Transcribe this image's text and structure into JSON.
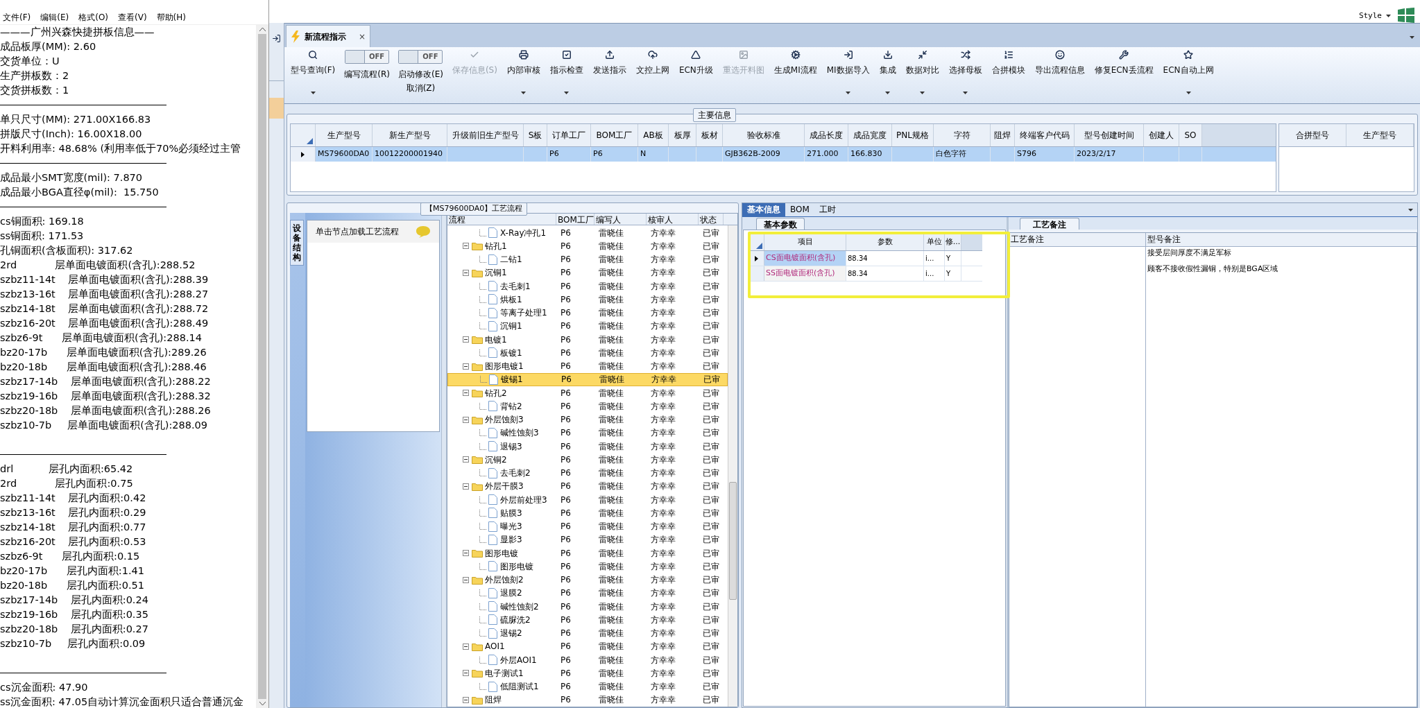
{
  "notepad": {
    "menu": [
      "文件(F)",
      "编辑(E)",
      "格式(O)",
      "查看(V)",
      "帮助(H)"
    ],
    "lines": [
      {
        "kind": "text",
        "text": "———广州兴森快捷拼板信息——"
      },
      {
        "kind": "text",
        "text": "成品板厚(MM): 2.60"
      },
      {
        "kind": "text",
        "text": "交货单位：U"
      },
      {
        "kind": "text",
        "text": "生产拼板数：2"
      },
      {
        "kind": "text",
        "text": "交货拼板数：1"
      },
      {
        "kind": "rule"
      },
      {
        "kind": "text",
        "text": "单只尺寸(MM): 271.00X166.83"
      },
      {
        "kind": "text",
        "text": "拼版尺寸(Inch): 16.00X18.00"
      },
      {
        "kind": "text",
        "text": "开料利用率: 48.68% (利用率低于70%必须经过主管"
      },
      {
        "kind": "rule"
      },
      {
        "kind": "text",
        "text": "成品最小SMT宽度(mil): 7.870"
      },
      {
        "kind": "text",
        "text": "成品最小BGA直径φ(mil):  15.750"
      },
      {
        "kind": "rule"
      },
      {
        "kind": "text",
        "text": "cs铜面积: 169.18"
      },
      {
        "kind": "text",
        "text": "ss铜面积: 171.53"
      },
      {
        "kind": "text",
        "text": "孔铜面积(含板面积): 317.62"
      },
      {
        "kind": "text",
        "text": "2rd            层单面电镀面积(含孔):288.52"
      },
      {
        "kind": "text",
        "text": "szbz11-14t    层单面电镀面积(含孔):288.39"
      },
      {
        "kind": "text",
        "text": "szbz13-16t    层单面电镀面积(含孔):288.27"
      },
      {
        "kind": "text",
        "text": "szbz14-18t    层单面电镀面积(含孔):288.72"
      },
      {
        "kind": "text",
        "text": "szbz16-20t    层单面电镀面积(含孔):288.49"
      },
      {
        "kind": "text",
        "text": "szbz6-9t      层单面电镀面积(含孔):288.14"
      },
      {
        "kind": "text",
        "text": "bz20-17b      层单面电镀面积(含孔):289.26"
      },
      {
        "kind": "text",
        "text": "bz20-18b      层单面电镀面积(含孔):288.46"
      },
      {
        "kind": "text",
        "text": "szbz17-14b    层单面电镀面积(含孔):288.22"
      },
      {
        "kind": "text",
        "text": "szbz19-16b    层单面电镀面积(含孔):288.32"
      },
      {
        "kind": "text",
        "text": "szbz20-18b    层单面电镀面积(含孔):288.26"
      },
      {
        "kind": "text",
        "text": "szbz10-7b     层单面电镀面积(含孔):288.09"
      },
      {
        "kind": "blank"
      },
      {
        "kind": "rule"
      },
      {
        "kind": "text",
        "text": "drl           层孔内面积:65.42"
      },
      {
        "kind": "text",
        "text": "2rd            层孔内面积:0.75"
      },
      {
        "kind": "text",
        "text": "szbz11-14t    层孔内面积:0.42"
      },
      {
        "kind": "text",
        "text": "szbz13-16t    层孔内面积:0.29"
      },
      {
        "kind": "text",
        "text": "szbz14-18t    层孔内面积:0.77"
      },
      {
        "kind": "text",
        "text": "szbz16-20t    层孔内面积:0.53"
      },
      {
        "kind": "text",
        "text": "szbz6-9t      层孔内面积:0.15"
      },
      {
        "kind": "text",
        "text": "bz20-17b      层孔内面积:1.41"
      },
      {
        "kind": "text",
        "text": "bz20-18b      层孔内面积:0.51"
      },
      {
        "kind": "text",
        "text": "szbz17-14b    层孔内面积:0.24"
      },
      {
        "kind": "text",
        "text": "szbz19-16b    层孔内面积:0.35"
      },
      {
        "kind": "text",
        "text": "szbz20-18b    层孔内面积:0.27"
      },
      {
        "kind": "text",
        "text": "szbz10-7b     层孔内面积:0.09"
      },
      {
        "kind": "blank"
      },
      {
        "kind": "rule"
      },
      {
        "kind": "text",
        "text": "cs沉金面积: 47.90"
      },
      {
        "kind": "text",
        "text": "ss沉金面积: 47.05自动计算沉金面积只适合普通沉金"
      }
    ]
  },
  "app": {
    "style_menu": "Style",
    "doc_tab": {
      "label": "新流程指示",
      "close": "×"
    },
    "ribbon": [
      {
        "kind": "button",
        "label": "型号查询(F)",
        "dropdown": true,
        "disabled": false
      },
      {
        "kind": "toggle",
        "switch": "OFF",
        "on": false,
        "label": "编写流程(R)"
      },
      {
        "kind": "toggle",
        "switch": "OFF",
        "on": false,
        "label": "启动修改(E)",
        "label2": "取消(Z)"
      },
      {
        "kind": "button",
        "label": "保存信息(S)",
        "dropdown": false,
        "disabled": true
      },
      {
        "kind": "button",
        "label": "内部审核",
        "dropdown": true,
        "disabled": false
      },
      {
        "kind": "button",
        "label": "指示检查",
        "dropdown": true,
        "disabled": false
      },
      {
        "kind": "button",
        "label": "发送指示",
        "dropdown": false,
        "disabled": false
      },
      {
        "kind": "button",
        "label": "文控上网",
        "dropdown": false,
        "disabled": false
      },
      {
        "kind": "button",
        "label": "ECN升级",
        "dropdown": false,
        "disabled": false
      },
      {
        "kind": "button",
        "label": "重选开料图",
        "dropdown": false,
        "disabled": true
      },
      {
        "kind": "button",
        "label": "生成MI流程",
        "dropdown": false,
        "disabled": false
      },
      {
        "kind": "button",
        "label": "MI数据导入",
        "dropdown": true,
        "disabled": false
      },
      {
        "kind": "button",
        "label": "集成",
        "dropdown": true,
        "disabled": false
      },
      {
        "kind": "button",
        "label": "数据对比",
        "dropdown": true,
        "disabled": false
      },
      {
        "kind": "button",
        "label": "选择母板",
        "dropdown": true,
        "disabled": false
      },
      {
        "kind": "button",
        "label": "合拼模块",
        "dropdown": false,
        "disabled": false
      },
      {
        "kind": "button",
        "label": "导出流程信息",
        "dropdown": false,
        "disabled": false
      },
      {
        "kind": "button",
        "label": "修复ECN丢流程",
        "dropdown": false,
        "disabled": false
      },
      {
        "kind": "button",
        "label": "ECN自动上网",
        "dropdown": true,
        "disabled": false
      }
    ],
    "main_info": {
      "title": "主要信息",
      "columns": [
        "生产型号",
        "新生产型号",
        "升级前旧生产型号",
        "S板",
        "订单工厂",
        "BOM工厂",
        "AB板",
        "板厚",
        "板材",
        "验收标准",
        "成品长度",
        "成品宽度",
        "PNL规格",
        "字符",
        "阻焊",
        "终端客户代码",
        "型号创建时间",
        "创建人",
        "SO"
      ],
      "rows": [
        {
          "selected": true,
          "cells": [
            "MS79600DA0",
            "10012200001940",
            "",
            "",
            "P6",
            "P6",
            "N",
            "",
            "",
            "GJB362B-2009",
            "271.000",
            "166.830",
            "",
            "白色字符",
            "",
            "S796",
            "2023/2/17",
            "",
            ""
          ]
        }
      ],
      "side_columns": [
        "合拼型号",
        "生产型号"
      ]
    },
    "process": {
      "side_tab": "设备结构",
      "hint": "单击节点加载工艺流程",
      "title": "【MS79600DA0】工艺流程",
      "columns": [
        "流程",
        "BOM工厂",
        "编写人",
        "核审人",
        "状态"
      ],
      "tree": [
        {
          "kind": "doc",
          "label": "X-Ray冲孔1",
          "bom": "P6",
          "author": "雷晓佳",
          "reviewer": "方幸幸",
          "status": "已审",
          "selected": false
        },
        {
          "kind": "folder",
          "label": "钻孔1",
          "bom": "P6",
          "author": "雷晓佳",
          "reviewer": "方幸幸",
          "status": "已审",
          "selected": false,
          "expanded": true,
          "children": [
            {
              "kind": "doc",
              "label": "二钻1",
              "bom": "P6",
              "author": "雷晓佳",
              "reviewer": "方幸幸",
              "status": "已审",
              "selected": false
            }
          ]
        },
        {
          "kind": "folder",
          "label": "沉铜1",
          "bom": "P6",
          "author": "雷晓佳",
          "reviewer": "方幸幸",
          "status": "已审",
          "selected": false,
          "expanded": true,
          "children": [
            {
              "kind": "doc",
              "label": "去毛刺1",
              "bom": "P6",
              "author": "雷晓佳",
              "reviewer": "方幸幸",
              "status": "已审",
              "selected": false
            },
            {
              "kind": "doc",
              "label": "烘板1",
              "bom": "P6",
              "author": "雷晓佳",
              "reviewer": "方幸幸",
              "status": "已审",
              "selected": false
            },
            {
              "kind": "doc",
              "label": "等离子处理1",
              "bom": "P6",
              "author": "雷晓佳",
              "reviewer": "方幸幸",
              "status": "已审",
              "selected": false
            },
            {
              "kind": "doc",
              "label": "沉铜1",
              "bom": "P6",
              "author": "雷晓佳",
              "reviewer": "方幸幸",
              "status": "已审",
              "selected": false
            }
          ]
        },
        {
          "kind": "folder",
          "label": "电镀1",
          "bom": "P6",
          "author": "雷晓佳",
          "reviewer": "方幸幸",
          "status": "已审",
          "selected": false,
          "expanded": true,
          "children": [
            {
              "kind": "doc",
              "label": "板镀1",
              "bom": "P6",
              "author": "雷晓佳",
              "reviewer": "方幸幸",
              "status": "已审",
              "selected": false
            }
          ]
        },
        {
          "kind": "folder",
          "label": "图形电镀1",
          "bom": "P6",
          "author": "雷晓佳",
          "reviewer": "方幸幸",
          "status": "已审",
          "selected": false,
          "expanded": true,
          "children": [
            {
              "kind": "doc",
              "label": "镀锡1",
              "bom": "P6",
              "author": "雷晓佳",
              "reviewer": "方幸幸",
              "status": "已审",
              "selected": true
            }
          ]
        },
        {
          "kind": "folder",
          "label": "钻孔2",
          "bom": "P6",
          "author": "雷晓佳",
          "reviewer": "方幸幸",
          "status": "已审",
          "selected": false,
          "expanded": true,
          "children": [
            {
              "kind": "doc",
              "label": "背钻2",
              "bom": "P6",
              "author": "雷晓佳",
              "reviewer": "方幸幸",
              "status": "已审",
              "selected": false
            }
          ]
        },
        {
          "kind": "folder",
          "label": "外层蚀刻3",
          "bom": "P6",
          "author": "雷晓佳",
          "reviewer": "方幸幸",
          "status": "已审",
          "selected": false,
          "expanded": true,
          "children": [
            {
              "kind": "doc",
              "label": "碱性蚀刻3",
              "bom": "P6",
              "author": "雷晓佳",
              "reviewer": "方幸幸",
              "status": "已审",
              "selected": false
            },
            {
              "kind": "doc",
              "label": "退锡3",
              "bom": "P6",
              "author": "雷晓佳",
              "reviewer": "方幸幸",
              "status": "已审",
              "selected": false
            }
          ]
        },
        {
          "kind": "folder",
          "label": "沉铜2",
          "bom": "P6",
          "author": "雷晓佳",
          "reviewer": "方幸幸",
          "status": "已审",
          "selected": false,
          "expanded": true,
          "children": [
            {
              "kind": "doc",
              "label": "去毛刺2",
              "bom": "P6",
              "author": "雷晓佳",
              "reviewer": "方幸幸",
              "status": "已审",
              "selected": false
            }
          ]
        },
        {
          "kind": "folder",
          "label": "外层干膜3",
          "bom": "P6",
          "author": "雷晓佳",
          "reviewer": "方幸幸",
          "status": "已审",
          "selected": false,
          "expanded": true,
          "children": [
            {
              "kind": "doc",
              "label": "外层前处理3",
              "bom": "P6",
              "author": "雷晓佳",
              "reviewer": "方幸幸",
              "status": "已审",
              "selected": false
            },
            {
              "kind": "doc",
              "label": "贴膜3",
              "bom": "P6",
              "author": "雷晓佳",
              "reviewer": "方幸幸",
              "status": "已审",
              "selected": false
            },
            {
              "kind": "doc",
              "label": "曝光3",
              "bom": "P6",
              "author": "雷晓佳",
              "reviewer": "方幸幸",
              "status": "已审",
              "selected": false
            },
            {
              "kind": "doc",
              "label": "显影3",
              "bom": "P6",
              "author": "雷晓佳",
              "reviewer": "方幸幸",
              "status": "已审",
              "selected": false
            }
          ]
        },
        {
          "kind": "folder",
          "label": "图形电镀",
          "bom": "P6",
          "author": "雷晓佳",
          "reviewer": "方幸幸",
          "status": "已审",
          "selected": false,
          "expanded": true,
          "children": [
            {
              "kind": "doc",
              "label": "图形电镀",
              "bom": "P6",
              "author": "雷晓佳",
              "reviewer": "方幸幸",
              "status": "已审",
              "selected": false
            }
          ]
        },
        {
          "kind": "folder",
          "label": "外层蚀刻2",
          "bom": "P6",
          "author": "雷晓佳",
          "reviewer": "方幸幸",
          "status": "已审",
          "selected": false,
          "expanded": true,
          "children": [
            {
              "kind": "doc",
              "label": "退膜2",
              "bom": "P6",
              "author": "雷晓佳",
              "reviewer": "方幸幸",
              "status": "已审",
              "selected": false
            },
            {
              "kind": "doc",
              "label": "碱性蚀刻2",
              "bom": "P6",
              "author": "雷晓佳",
              "reviewer": "方幸幸",
              "status": "已审",
              "selected": false
            },
            {
              "kind": "doc",
              "label": "硫脲洗2",
              "bom": "P6",
              "author": "雷晓佳",
              "reviewer": "方幸幸",
              "status": "已审",
              "selected": false
            },
            {
              "kind": "doc",
              "label": "退锡2",
              "bom": "P6",
              "author": "雷晓佳",
              "reviewer": "方幸幸",
              "status": "已审",
              "selected": false
            }
          ]
        },
        {
          "kind": "folder",
          "label": "AOI1",
          "bom": "P6",
          "author": "雷晓佳",
          "reviewer": "方幸幸",
          "status": "已审",
          "selected": false,
          "expanded": true,
          "children": [
            {
              "kind": "doc",
              "label": "外层AOI1",
              "bom": "P6",
              "author": "雷晓佳",
              "reviewer": "方幸幸",
              "status": "已审",
              "selected": false
            }
          ]
        },
        {
          "kind": "folder",
          "label": "电子测试1",
          "bom": "P6",
          "author": "雷晓佳",
          "reviewer": "方幸幸",
          "status": "已审",
          "selected": false,
          "expanded": true,
          "children": [
            {
              "kind": "doc",
              "label": "低阻测试1",
              "bom": "P6",
              "author": "雷晓佳",
              "reviewer": "方幸幸",
              "status": "已审",
              "selected": false
            }
          ]
        },
        {
          "kind": "folder",
          "label": "阻焊",
          "bom": "P6",
          "author": "雷晓佳",
          "reviewer": "方幸幸",
          "status": "已审",
          "selected": false,
          "expanded": true
        }
      ]
    },
    "detail": {
      "tabs": [
        {
          "label": "基本信息",
          "selected": true
        },
        {
          "label": "BOM",
          "selected": false
        },
        {
          "label": "工时",
          "selected": false
        }
      ],
      "params": {
        "tab": "基本参数",
        "columns": [
          "项目",
          "参数",
          "单位",
          "修..."
        ],
        "rows": [
          {
            "selected": true,
            "cells": [
              "CS面电镀面积(含孔)",
              "88.34",
              "i...",
              "Y"
            ]
          },
          {
            "selected": false,
            "cells": [
              "SS面电镀面积(含孔)",
              "88.34",
              "i...",
              "Y"
            ]
          }
        ]
      },
      "notes": {
        "tab": "工艺备注",
        "columns": [
          "工艺备注",
          "型号备注"
        ],
        "model_notes": [
          "接受层间厚度不满足军标",
          "顾客不接收假性漏铜，特别是BGA区域"
        ]
      }
    }
  }
}
